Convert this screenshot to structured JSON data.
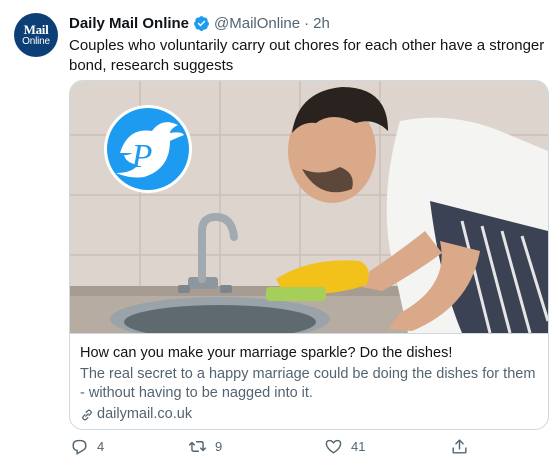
{
  "author": {
    "display_name": "Daily Mail Online",
    "handle": "@MailOnline",
    "separator": "·",
    "time": "2h",
    "avatar_line1": "Mail",
    "avatar_line2": "Online",
    "verified": true
  },
  "tweet": {
    "text": "Couples who voluntarily carry out chores for each other have a stronger bond, research suggests"
  },
  "card": {
    "image": "man-washing-dishes-photo",
    "watermark_letter": "P",
    "title": "How can you make your marriage sparkle? Do the dishes!",
    "description": "The real secret to a happy marriage could be doing the dishes for them - without having to be nagged into it.",
    "domain": "dailymail.co.uk"
  },
  "actions": {
    "reply_count": "4",
    "retweet_count": "9",
    "like_count": "41"
  },
  "colors": {
    "text_primary": "#0f1419",
    "text_secondary": "#536471",
    "verified_blue": "#1d9bf0",
    "border": "#cfd9de",
    "avatar_navy": "#0d3f77"
  },
  "icons": [
    "verified-icon",
    "link-icon",
    "reply-icon",
    "retweet-icon",
    "like-icon",
    "share-icon",
    "bird-logo-icon"
  ]
}
